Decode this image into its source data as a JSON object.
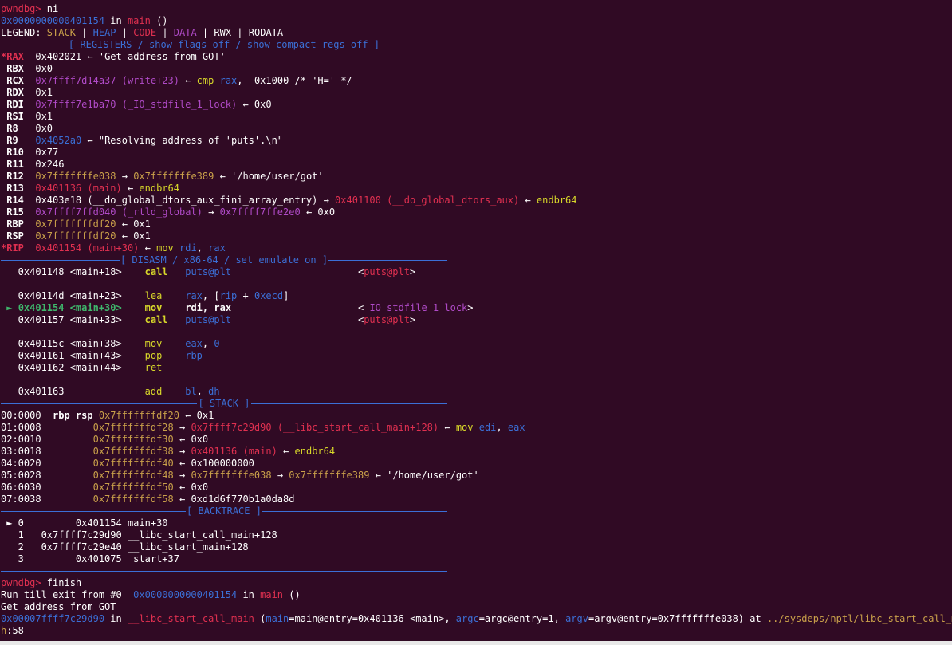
{
  "colors": {
    "background": "#300a24",
    "text": "#ffffff",
    "prompt": "#e03050",
    "address": "#3b6fd6",
    "stack": "#c9a04a",
    "heap": "#3b6fd6",
    "code": "#e03050",
    "data": "#b04bc8",
    "mnemonic": "#d8d82a",
    "register_name": "#ffffff",
    "changed_register": "#e03050",
    "current_instruction": "#3fb66c",
    "separator": "#3b6fd6",
    "path": "#c9a04a"
  },
  "lines": [
    [
      [
        "pwndbg>",
        "prompt"
      ],
      [
        " ni",
        "text"
      ]
    ],
    [
      [
        "0x0000000000401154",
        "address"
      ],
      [
        " in ",
        "text"
      ],
      [
        "main",
        "code"
      ],
      [
        " ()",
        "text"
      ]
    ],
    [
      [
        "LEGEND: ",
        "text"
      ],
      [
        "STACK",
        "stack"
      ],
      [
        " | ",
        "text"
      ],
      [
        "HEAP",
        "heap"
      ],
      [
        " | ",
        "text"
      ],
      [
        "CODE",
        "code"
      ],
      [
        " | ",
        "text"
      ],
      [
        "DATA",
        "data"
      ],
      [
        " | ",
        "text"
      ],
      [
        "RWX",
        "text_u"
      ],
      [
        " | ",
        "text"
      ],
      [
        "RODATA",
        "text"
      ]
    ],
    null,
    [
      [
        "*RAX",
        "changed_register"
      ],
      [
        "  0x402021 ",
        "text"
      ],
      [
        "←",
        "text"
      ],
      [
        " 'Get address from GOT'",
        "text"
      ]
    ],
    [
      [
        " RBX",
        "register_name"
      ],
      [
        "  0x0",
        "text"
      ]
    ],
    [
      [
        " RCX",
        "register_name"
      ],
      [
        "  ",
        "text"
      ],
      [
        "0x7ffff7d14a37 (write+23)",
        "data"
      ],
      [
        " ← ",
        "text"
      ],
      [
        "cmp",
        "mnemonic"
      ],
      [
        " ",
        "text"
      ],
      [
        "rax",
        "address"
      ],
      [
        ", -0x1000 /* 'H=' */",
        "text"
      ]
    ],
    [
      [
        " RDX",
        "register_name"
      ],
      [
        "  0x1",
        "text"
      ]
    ],
    [
      [
        " RDI",
        "register_name"
      ],
      [
        "  ",
        "text"
      ],
      [
        "0x7ffff7e1ba70 (_IO_stdfile_1_lock)",
        "data"
      ],
      [
        " ← 0x0",
        "text"
      ]
    ],
    [
      [
        " RSI",
        "register_name"
      ],
      [
        "  0x1",
        "text"
      ]
    ],
    [
      [
        " R8",
        "register_name"
      ],
      [
        "   0x0",
        "text"
      ]
    ],
    [
      [
        " R9",
        "register_name"
      ],
      [
        "   ",
        "text"
      ],
      [
        "0x4052a0",
        "address"
      ],
      [
        " ← \"Resolving address of 'puts'.\\n\"",
        "text"
      ]
    ],
    [
      [
        " R10",
        "register_name"
      ],
      [
        "  0x77",
        "text"
      ]
    ],
    [
      [
        " R11",
        "register_name"
      ],
      [
        "  0x246",
        "text"
      ]
    ],
    [
      [
        " R12",
        "register_name"
      ],
      [
        "  ",
        "text"
      ],
      [
        "0x7fffffffe038",
        "stack"
      ],
      [
        " → ",
        "text"
      ],
      [
        "0x7fffffffe389",
        "stack"
      ],
      [
        " ← '/home/user/got'",
        "text"
      ]
    ],
    [
      [
        " R13",
        "register_name"
      ],
      [
        "  ",
        "text"
      ],
      [
        "0x401136 (main)",
        "code"
      ],
      [
        " ← ",
        "text"
      ],
      [
        "endbr64",
        "mnemonic"
      ]
    ],
    [
      [
        " R14",
        "register_name"
      ],
      [
        "  0x403e18 (__do_global_dtors_aux_fini_array_entry) → ",
        "text"
      ],
      [
        "0x401100 (__do_global_dtors_aux)",
        "code"
      ],
      [
        " ← ",
        "text"
      ],
      [
        "endbr64",
        "mnemonic"
      ]
    ],
    [
      [
        " R15",
        "register_name"
      ],
      [
        "  ",
        "text"
      ],
      [
        "0x7ffff7ffd040 (_rtld_global)",
        "data"
      ],
      [
        " → ",
        "text"
      ],
      [
        "0x7ffff7ffe2e0",
        "data"
      ],
      [
        " ← 0x0",
        "text"
      ]
    ],
    [
      [
        " RBP",
        "register_name"
      ],
      [
        "  ",
        "text"
      ],
      [
        "0x7fffffffdf20",
        "stack"
      ],
      [
        " ← 0x1",
        "text"
      ]
    ],
    [
      [
        " RSP",
        "register_name"
      ],
      [
        "  ",
        "text"
      ],
      [
        "0x7fffffffdf20",
        "stack"
      ],
      [
        " ← 0x1",
        "text"
      ]
    ],
    [
      [
        "*RIP",
        "changed_register"
      ],
      [
        "  ",
        "text"
      ],
      [
        "0x401154 (main+30)",
        "code"
      ],
      [
        " ← ",
        "text"
      ],
      [
        "mov",
        "mnemonic"
      ],
      [
        " ",
        "text"
      ],
      [
        "rdi",
        "address"
      ],
      [
        ", ",
        "text"
      ],
      [
        "rax",
        "address"
      ]
    ],
    null,
    [
      [
        "   0x401148 <main+18>    ",
        "text"
      ],
      [
        "call",
        "mnemonic_b"
      ],
      [
        "   ",
        "text"
      ],
      [
        "puts@plt",
        "address"
      ],
      [
        "                      <",
        "text"
      ],
      [
        "puts@plt",
        "code"
      ],
      [
        ">",
        "text"
      ]
    ],
    [
      [
        "",
        "text"
      ]
    ],
    [
      [
        "   0x40114d <main+23>    ",
        "text"
      ],
      [
        "lea",
        "mnemonic"
      ],
      [
        "    ",
        "text"
      ],
      [
        "rax",
        "address"
      ],
      [
        ", [",
        "text"
      ],
      [
        "rip",
        "address"
      ],
      [
        " + ",
        "text"
      ],
      [
        "0xecd",
        "address"
      ],
      [
        "]",
        "text"
      ]
    ],
    [
      [
        " ► ",
        "current_instruction"
      ],
      [
        "0x401154 <main+30>    ",
        "current_instruction_b"
      ],
      [
        "mov",
        "mnemonic_b"
      ],
      [
        "    ",
        "text"
      ],
      [
        "rdi",
        "text_b"
      ],
      [
        ", ",
        "text_b"
      ],
      [
        "rax",
        "text_b"
      ],
      [
        "                      <",
        "text"
      ],
      [
        "_IO_stdfile_1_lock",
        "data"
      ],
      [
        ">",
        "text"
      ]
    ],
    [
      [
        "   0x401157 <main+33>    ",
        "text"
      ],
      [
        "call",
        "mnemonic_b"
      ],
      [
        "   ",
        "text"
      ],
      [
        "puts@plt",
        "address"
      ],
      [
        "                      <",
        "text"
      ],
      [
        "puts@plt",
        "code"
      ],
      [
        ">",
        "text"
      ]
    ],
    [
      [
        "",
        "text"
      ]
    ],
    [
      [
        "   0x40115c <main+38>    ",
        "text"
      ],
      [
        "mov",
        "mnemonic"
      ],
      [
        "    ",
        "text"
      ],
      [
        "eax",
        "address"
      ],
      [
        ", ",
        "text"
      ],
      [
        "0",
        "address"
      ]
    ],
    [
      [
        "   0x401161 <main+43>    ",
        "text"
      ],
      [
        "pop",
        "mnemonic"
      ],
      [
        "    ",
        "text"
      ],
      [
        "rbp",
        "address"
      ]
    ],
    [
      [
        "   0x401162 <main+44>    ",
        "text"
      ],
      [
        "ret",
        "mnemonic"
      ]
    ],
    [
      [
        "",
        "text"
      ]
    ],
    [
      [
        "   0x401163              ",
        "text"
      ],
      [
        "add",
        "mnemonic"
      ],
      [
        "    ",
        "text"
      ],
      [
        "bl",
        "address"
      ],
      [
        ", ",
        "text"
      ],
      [
        "dh",
        "address"
      ]
    ],
    null,
    [
      [
        "00:0000",
        "text"
      ],
      [
        "  ",
        "text"
      ],
      [
        "rbp rsp",
        "text_b"
      ],
      [
        " ",
        "text"
      ],
      [
        "0x7fffffffdf20",
        "stack"
      ],
      [
        " ← 0x1",
        "text"
      ]
    ],
    [
      [
        "01:0008",
        "text"
      ],
      [
        "         ",
        "text"
      ],
      [
        "0x7fffffffdf28",
        "stack"
      ],
      [
        " → ",
        "text"
      ],
      [
        "0x7ffff7c29d90 (__libc_start_call_main+128)",
        "code"
      ],
      [
        " ← ",
        "text"
      ],
      [
        "mov",
        "mnemonic"
      ],
      [
        " ",
        "text"
      ],
      [
        "edi",
        "address"
      ],
      [
        ", ",
        "text"
      ],
      [
        "eax",
        "address"
      ]
    ],
    [
      [
        "02:0010",
        "text"
      ],
      [
        "         ",
        "text"
      ],
      [
        "0x7fffffffdf30",
        "stack"
      ],
      [
        " ← 0x0",
        "text"
      ]
    ],
    [
      [
        "03:0018",
        "text"
      ],
      [
        "         ",
        "text"
      ],
      [
        "0x7fffffffdf38",
        "stack"
      ],
      [
        " → ",
        "text"
      ],
      [
        "0x401136 (main)",
        "code"
      ],
      [
        " ← ",
        "text"
      ],
      [
        "endbr64",
        "mnemonic"
      ]
    ],
    [
      [
        "04:0020",
        "text"
      ],
      [
        "         ",
        "text"
      ],
      [
        "0x7fffffffdf40",
        "stack"
      ],
      [
        " ← 0x100000000",
        "text"
      ]
    ],
    [
      [
        "05:0028",
        "text"
      ],
      [
        "         ",
        "text"
      ],
      [
        "0x7fffffffdf48",
        "stack"
      ],
      [
        " → ",
        "text"
      ],
      [
        "0x7fffffffe038",
        "stack"
      ],
      [
        " → ",
        "text"
      ],
      [
        "0x7fffffffe389",
        "stack"
      ],
      [
        " ← '/home/user/got'",
        "text"
      ]
    ],
    [
      [
        "06:0030",
        "text"
      ],
      [
        "         ",
        "text"
      ],
      [
        "0x7fffffffdf50",
        "stack"
      ],
      [
        " ← 0x0",
        "text"
      ]
    ],
    [
      [
        "07:0038",
        "text"
      ],
      [
        "         ",
        "text"
      ],
      [
        "0x7fffffffdf58",
        "stack"
      ],
      [
        " ← 0xd1d6f770b1a0da8d",
        "text"
      ]
    ],
    null,
    [
      [
        " ► 0         0x401154 main+30",
        "text"
      ]
    ],
    [
      [
        "   1   0x7ffff7c29d90 __libc_start_call_main+128",
        "text"
      ]
    ],
    [
      [
        "   2   0x7ffff7c29e40 __libc_start_main+128",
        "text"
      ]
    ],
    [
      [
        "   3         0x401075 _start+37",
        "text"
      ]
    ],
    null,
    [
      [
        "pwndbg>",
        "prompt"
      ],
      [
        " finish",
        "text"
      ]
    ],
    [
      [
        "Run till exit from #0  ",
        "text"
      ],
      [
        "0x0000000000401154",
        "address"
      ],
      [
        " in ",
        "text"
      ],
      [
        "main",
        "code"
      ],
      [
        " ()",
        "text"
      ]
    ],
    [
      [
        "Get address from GOT",
        "text"
      ]
    ],
    [
      [
        "0x00007ffff7c29d90",
        "address"
      ],
      [
        " in ",
        "text"
      ],
      [
        "__libc_start_call_main",
        "code"
      ],
      [
        " (",
        "text"
      ],
      [
        "main",
        "address"
      ],
      [
        "=main@entry=0x401136 <main>, ",
        "text"
      ],
      [
        "argc",
        "address"
      ],
      [
        "=argc@entry=1, ",
        "text"
      ],
      [
        "argv",
        "address"
      ],
      [
        "=argv@entry=0x7fffffffe038) at ",
        "text"
      ],
      [
        "../sysdeps/nptl/libc_start_call_main.",
        "path"
      ]
    ],
    [
      [
        "h",
        "path"
      ],
      [
        ":58",
        "text"
      ]
    ]
  ],
  "separators": [
    {
      "after_line": 3,
      "label": "[ REGISTERS / show-flags off / show-compact-regs off ]"
    },
    {
      "after_line": 21,
      "label": "[ DISASM / x86-64 / set emulate on ]"
    },
    {
      "after_line": 33,
      "label": "[ STACK ]"
    },
    {
      "after_line": 42,
      "label": "[ BACKTRACE ]"
    },
    {
      "after_line": 47,
      "label": ""
    }
  ]
}
